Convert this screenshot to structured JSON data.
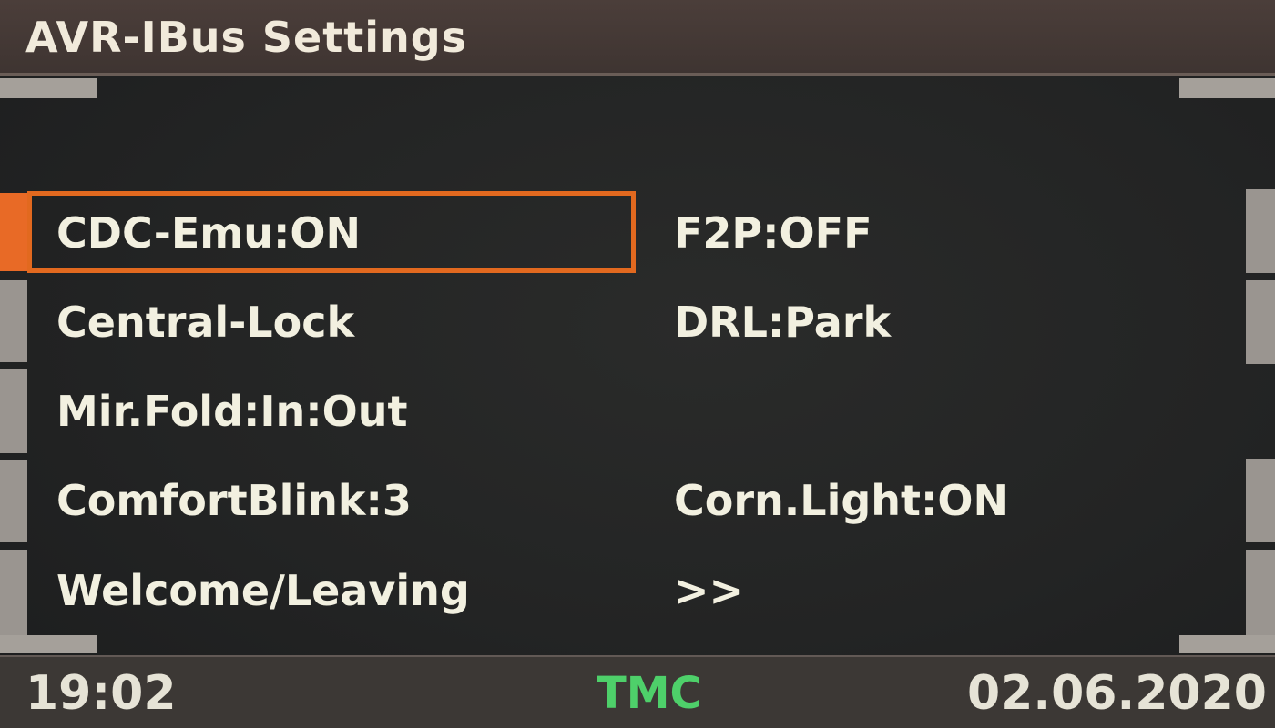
{
  "header": {
    "title": "AVR-IBus Settings"
  },
  "menu": {
    "left": [
      {
        "label": "CDC-Emu:ON",
        "selected": true
      },
      {
        "label": "Central-Lock",
        "selected": false
      },
      {
        "label": "Mir.Fold:In:Out",
        "selected": false
      },
      {
        "label": "ComfortBlink:3",
        "selected": false
      },
      {
        "label": "Welcome/Leaving",
        "selected": false
      }
    ],
    "right": [
      {
        "label": "F2P:OFF"
      },
      {
        "label": "DRL:Park"
      },
      {
        "label": ""
      },
      {
        "label": "Corn.Light:ON"
      },
      {
        "label": ">>"
      }
    ]
  },
  "status_bar": {
    "time": "19:02",
    "tmc": "TMC",
    "date": "02.06.2020"
  },
  "colors": {
    "selection": "#e2691f",
    "tmc": "#4ed06a",
    "text": "#f2f0e0",
    "background": "#232424"
  }
}
